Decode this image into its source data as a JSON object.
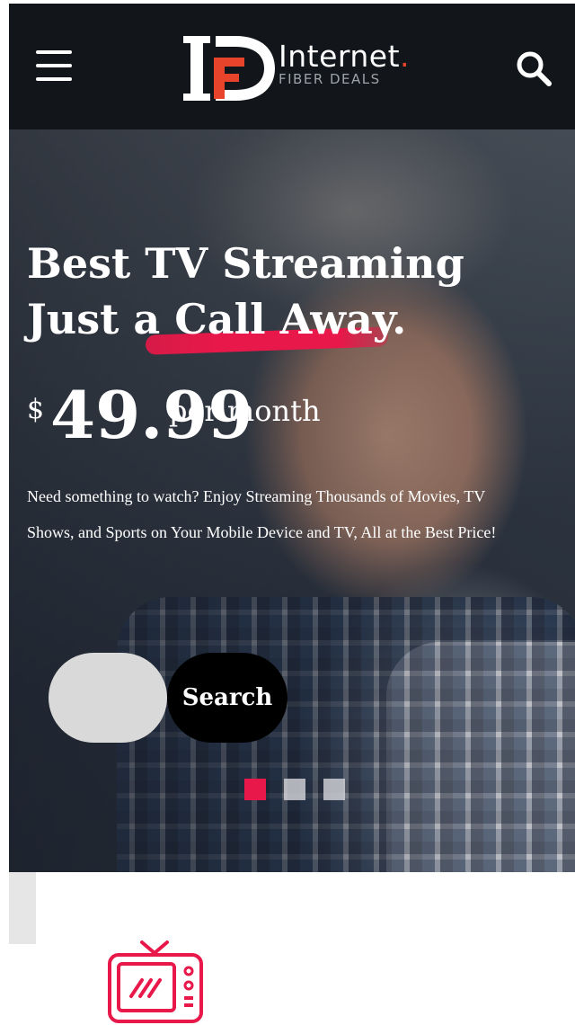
{
  "header": {
    "logo_word": "Internet",
    "logo_dot": ".",
    "logo_sub": "FIBER DEALS",
    "icons": {
      "menu": "hamburger-icon",
      "search": "search-icon"
    }
  },
  "hero": {
    "title_line1": "Best TV Streaming",
    "title_line2": "Just a Call Away.",
    "price": {
      "currency": "$",
      "amount": "49.99",
      "unit": "per month"
    },
    "description": "Need something to watch? Enjoy Streaming Thousands of Movies, TV Shows, and Sports on Your Mobile Device and TV, All at the Best Price!",
    "search_input_value": "",
    "search_button_label": "Search",
    "slider": {
      "slides": 3,
      "active_index": 0
    }
  },
  "feature": {
    "icon": "tv-icon"
  },
  "colors": {
    "header_bg": "#12151a",
    "accent": "#e8184a",
    "logo_accent": "#e8442c",
    "button_bg": "#000000",
    "input_bg": "#d9d9d9"
  }
}
